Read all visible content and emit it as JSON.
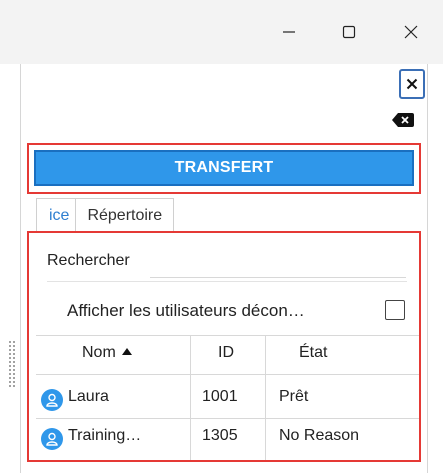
{
  "window": {
    "minimize_icon": "minimize-icon",
    "maximize_icon": "maximize-icon",
    "close_icon": "close-icon"
  },
  "panel": {
    "close_icon": "close-icon",
    "clear_icon": "backspace-icon"
  },
  "transfer_button": {
    "label": "TRANSFERT",
    "color": "#2f97ea"
  },
  "tabs": [
    {
      "label": "ice",
      "active": true
    },
    {
      "label": "Répertoire",
      "active": false
    }
  ],
  "search": {
    "label": "Rechercher",
    "value": ""
  },
  "show_offline": {
    "label": "Afficher les utilisateurs décon…",
    "checked": false
  },
  "table": {
    "columns": [
      {
        "label": "Nom",
        "sort": "ascending"
      },
      {
        "label": "ID"
      },
      {
        "label": "État"
      }
    ],
    "rows": [
      {
        "name": "Laura",
        "id": "1001",
        "state": "Prêt",
        "icon": "user-icon"
      },
      {
        "name": "Training…",
        "id": "1305",
        "state": "No Reason",
        "icon": "user-icon"
      }
    ]
  }
}
